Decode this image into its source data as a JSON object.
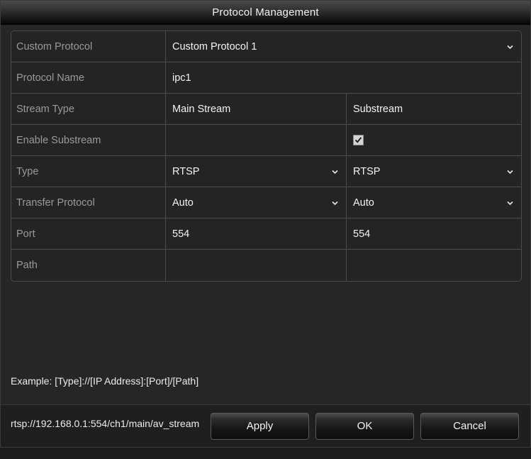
{
  "window": {
    "title": "Protocol Management"
  },
  "table": {
    "rows": [
      {
        "label": "Custom Protocol",
        "kind": "full-dropdown",
        "value": "Custom Protocol 1",
        "chevron": "chevron-down-icon"
      },
      {
        "label": "Protocol Name",
        "kind": "full-text",
        "value": "ipc1"
      },
      {
        "label": "Stream Type",
        "kind": "split-text",
        "main": "Main Stream",
        "sub": "Substream"
      },
      {
        "label": "Enable Substream",
        "kind": "split-checkbox",
        "main": "",
        "sub_checked": true
      },
      {
        "label": "Type",
        "kind": "split-dropdown",
        "main": "RTSP",
        "sub": "RTSP",
        "chevron": "chevron-down-icon"
      },
      {
        "label": "Transfer Protocol",
        "kind": "split-dropdown",
        "main": "Auto",
        "sub": "Auto",
        "chevron": "chevron-down-icon"
      },
      {
        "label": "Port",
        "kind": "split-text",
        "main": "554",
        "sub": "554"
      },
      {
        "label": "Path",
        "kind": "split-text",
        "main": "",
        "sub": ""
      }
    ]
  },
  "hint": {
    "line1": "Example: [Type]://[IP Address]:[Port]/[Path]",
    "line2": "rtsp://192.168.0.1:554/ch1/main/av_stream"
  },
  "footer": {
    "apply_label": "Apply",
    "ok_label": "OK",
    "cancel_label": "Cancel"
  },
  "colors": {
    "window_bg": "#262626",
    "text_primary": "#f4f4f4",
    "text_label": "#9a9a9a",
    "border": "#4b4b4b",
    "checkbox_bg": "#d4d4d4"
  }
}
